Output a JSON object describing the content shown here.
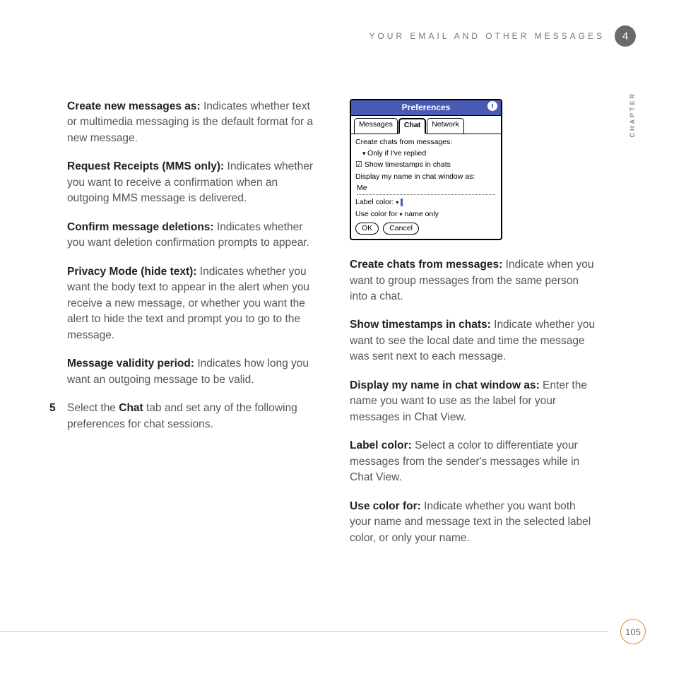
{
  "header": {
    "title": "YOUR EMAIL AND OTHER MESSAGES",
    "chapter_num": "4",
    "side_label": "CHAPTER"
  },
  "left": {
    "p1": {
      "bold": "Create new messages as:",
      "text": " Indicates whether text or multimedia messaging is the default format for a new message."
    },
    "p2": {
      "bold": "Request Receipts (MMS only):",
      "text": " Indicates whether you want to receive a confirmation when an outgoing MMS message is delivered."
    },
    "p3": {
      "bold": "Confirm message deletions:",
      "text": " Indicates whether you want deletion confirmation prompts to appear."
    },
    "p4": {
      "bold": "Privacy Mode (hide text):",
      "text": " Indicates whether you want the body text to appear in the alert when you receive a new message, or whether you want the alert to hide the text and prompt you to go to the message."
    },
    "p5": {
      "bold": "Message validity period:",
      "text": " Indicates how long you want an outgoing message to be valid."
    },
    "step": {
      "num": "5",
      "pre": "Select the ",
      "bold": "Chat",
      "post": " tab and set any of the following preferences for chat sessions."
    }
  },
  "screenshot": {
    "title": "Preferences",
    "tabs": [
      "Messages",
      "Chat",
      "Network"
    ],
    "line1": "Create chats from messages:",
    "dd1": "Only if I've replied",
    "chk": "Show timestamps in chats",
    "line2": "Display my name in chat window as:",
    "field": "Me",
    "label_color": "Label color:",
    "use_for": "Use color for",
    "use_for_val": "name only",
    "btn_ok": "OK",
    "btn_cancel": "Cancel"
  },
  "right": {
    "p1": {
      "bold": "Create chats from messages:",
      "text": " Indicate when you want to group messages from the same person into a chat."
    },
    "p2": {
      "bold": "Show timestamps in chats:",
      "text": " Indicate whether you want to see the local date and time the message was sent next to each message."
    },
    "p3": {
      "bold": "Display my name in chat window as:",
      "text": " Enter the name you want to use as the label for your messages in Chat View."
    },
    "p4": {
      "bold": "Label color:",
      "text": " Select a color to differentiate your messages from the sender's messages while in Chat View."
    },
    "p5": {
      "bold": "Use color for:",
      "text": " Indicate whether you want both your name and message text in the selected label color, or only your name."
    }
  },
  "page_number": "105"
}
